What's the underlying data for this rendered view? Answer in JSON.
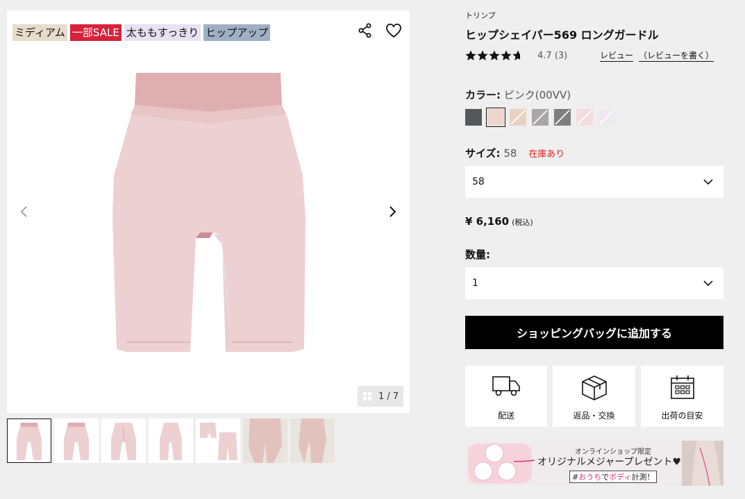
{
  "gallery": {
    "badges": [
      "ミディアム",
      "一部SALE",
      "太ももすっきり",
      "ヒップアップ"
    ],
    "counter": "1 / 7",
    "thumbnail_count": 7
  },
  "product": {
    "brand": "トリンプ",
    "title": "ヒップシェイパー569 ロングガードル",
    "rating": 4.7,
    "rating_text": "4.7",
    "review_count": "(3)",
    "review_link": "レビュー",
    "write_review_link": "（レビューを書く）",
    "color_label": "カラー:",
    "color_value": "ピンク(00VV)",
    "size_label": "サイズ:",
    "size_value": "58",
    "stock_status": "在庫あり",
    "size_selected": "58",
    "price": "¥ 6,160",
    "tax_note": "(税込)",
    "qty_label": "数量:",
    "qty_selected": "1",
    "add_to_bag": "ショッピングバッグに追加する"
  },
  "swatches": [
    {
      "color": "#555759",
      "selected": false
    },
    {
      "color": "#f0d5cf",
      "selected": true
    },
    {
      "color": "#e9d2c2",
      "selected": false
    },
    {
      "color": "#a9a6a8",
      "selected": false
    },
    {
      "color": "#7f7f80",
      "selected": false
    },
    {
      "color": "#f4dddf",
      "selected": false
    },
    {
      "color": "#efe9f2",
      "selected": false
    }
  ],
  "info": {
    "delivery": "配送",
    "returns": "返品・交換",
    "shipping_estimate": "出荷の目安"
  },
  "banner": {
    "small": "オンラインショップ限定",
    "main": "オリジナルメジャープレゼント♥",
    "tag_prefix": "#",
    "tag_pink1": "おうち",
    "tag_mid": "で",
    "tag_pink2": "ボディ",
    "tag_suffix": "計測！"
  }
}
